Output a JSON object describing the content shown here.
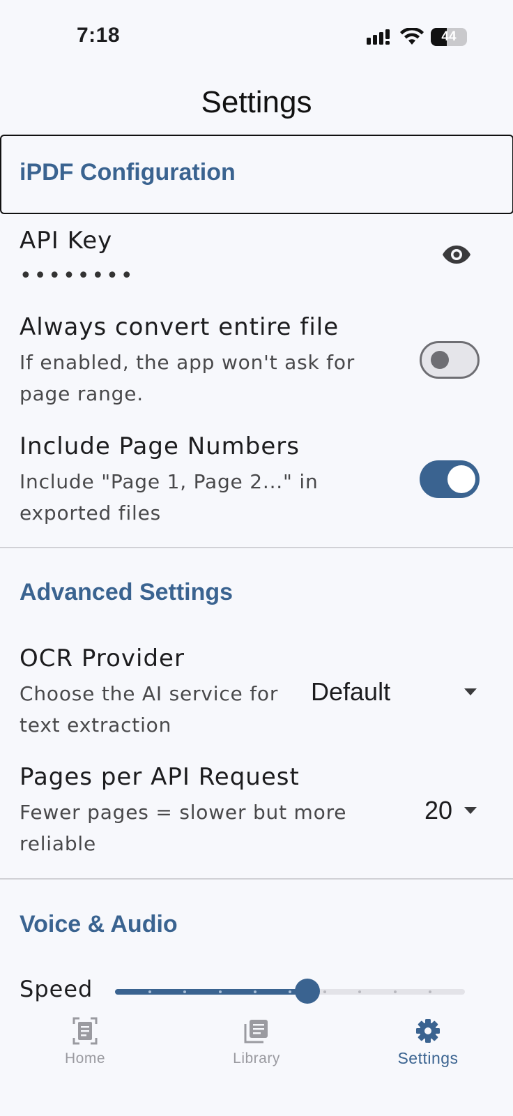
{
  "status_bar": {
    "time": "7:18",
    "battery": "44",
    "battery_level": 0.44,
    "icons": [
      "signal-icon",
      "wifi-icon",
      "battery-icon"
    ]
  },
  "header": {
    "title": "Settings"
  },
  "sections": {
    "ipdf": {
      "title": "iPDF Configuration"
    },
    "advanced": {
      "title": "Advanced Settings"
    },
    "voice": {
      "title": "Voice & Audio"
    }
  },
  "api_key": {
    "label": "API Key",
    "masked_value": "••••••••",
    "icon": "eye-icon"
  },
  "convert_entire_file": {
    "label": "Always convert entire file",
    "description_line1": "If enabled, the app won't ask for",
    "description_line2": "page range.",
    "enabled": false
  },
  "page_numbers": {
    "label": "Include Page Numbers",
    "description_line1": "Include \"Page 1, Page 2...\" in",
    "description_line2": "exported files",
    "enabled": true
  },
  "ocr_provider": {
    "label": "OCR Provider",
    "description_line1": "Choose the AI service for",
    "description_line2": "text extraction",
    "value": "Default"
  },
  "pages_per_request": {
    "label": "Pages per API Request",
    "description_line1": "Fewer pages = slower but more",
    "description_line2": "reliable",
    "value": "20"
  },
  "speed": {
    "label": "Speed",
    "level": 0.55,
    "steps": 10
  },
  "tabs": [
    {
      "label": "Home",
      "icon": "document-scan-icon",
      "active": false
    },
    {
      "label": "Library",
      "icon": "library-icon",
      "active": false
    },
    {
      "label": "Settings",
      "icon": "gear-icon",
      "active": true
    }
  ],
  "colors": {
    "accent": "#3a6390",
    "inactive_tab": "#9a9aa0",
    "background": "#f7f8fc"
  }
}
